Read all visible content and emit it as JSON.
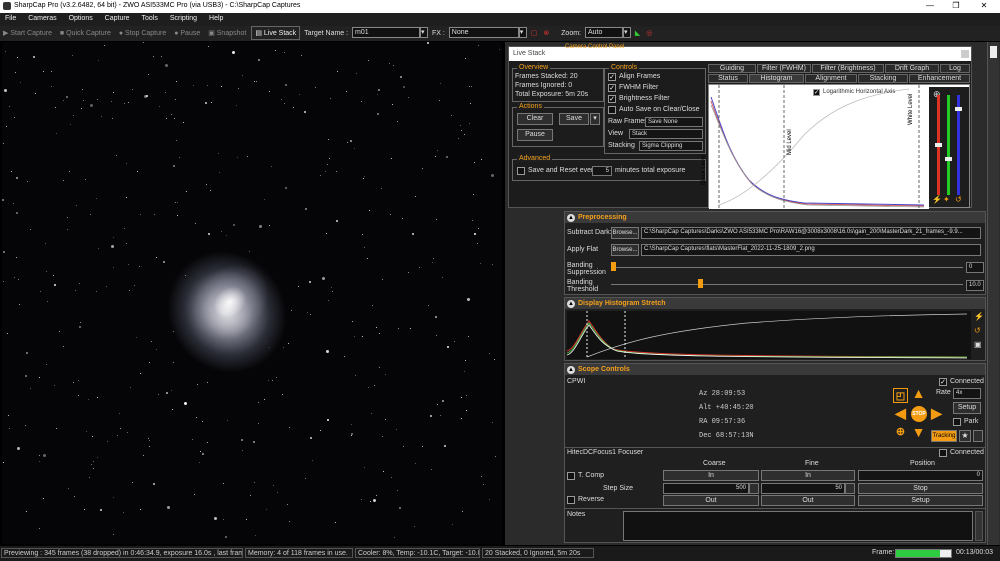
{
  "window": {
    "title": "SharpCap Pro (v3.2.6482, 64 bit) - ZWO ASI533MC Pro (via USB3) - C:\\SharpCap Captures",
    "minimize": "—",
    "maximize": "❐",
    "close": "✕"
  },
  "menu": [
    "File",
    "Cameras",
    "Options",
    "Capture",
    "Tools",
    "Scripting",
    "Help"
  ],
  "toolbar": {
    "start_capture": "Start Capture",
    "quick_capture": "Quick Capture",
    "stop_capture": "Stop Capture",
    "pause": "Pause",
    "snapshot": "Snapshot",
    "live_stack": "Live Stack",
    "target_label": "Target Name :",
    "target_value": "m01",
    "fx_label": "FX :",
    "fx_value": "None",
    "zoom_label": "Zoom:",
    "zoom_value": "Auto"
  },
  "live_stack": {
    "title": "Live Stack",
    "camera_panel_title": "Camera Control Panel",
    "overview": {
      "title": "Overview",
      "frames_stacked": "Frames Stacked: 20",
      "frames_ignored": "Frames Ignored: 0",
      "total_exposure": "Total Exposure: 5m 20s"
    },
    "actions": {
      "title": "Actions",
      "clear": "Clear",
      "save": "Save",
      "pause": "Pause"
    },
    "controls": {
      "title": "Controls",
      "align_frames": "Align Frames",
      "fwhm_filter": "FWHM Filter",
      "brightness_filter": "Brightness Filter",
      "auto_save": "Auto Save on Clear/Close",
      "raw_frames_label": "Raw Frames",
      "raw_frames_value": "Save None",
      "view_label": "View",
      "view_value": "Stack",
      "stacking_label": "Stacking",
      "stacking_value": "Sigma Clipping"
    },
    "advanced": {
      "title": "Advanced",
      "save_reset": "Save and Reset every",
      "minutes_value": "5",
      "minutes_label": "minutes total exposure"
    },
    "tabs_top": [
      "Guiding",
      "Filter (FWHM)",
      "Filter (Brightness)",
      "Drift Graph",
      "Log"
    ],
    "tabs_bottom": [
      "Status",
      "Histogram",
      "Alignment",
      "Stacking",
      "Enhancement"
    ],
    "histogram": {
      "log_axis": "Logarithmic Horizontal Axis",
      "black_level": "Black Level",
      "mid_level": "Mid Level",
      "white_level": "White Level"
    }
  },
  "preprocessing": {
    "title": "Preprocessing",
    "subtract_dark_label": "Subtract Dark:",
    "browse": "Browse...",
    "dark_path": "C:\\SharpCap Captures\\Darks\\ZWO ASI533MC Pro\\RAW16@3008x3008\\16.0s\\gain_200\\MasterDark_21_frames_-9.9...",
    "apply_flat_label": "Apply Flat",
    "flat_path": "C:\\SharpCap Captures\\flats\\MasterFlat_2022-11-25-1809_2.png",
    "banding_suppression": "Banding Suppression",
    "banding_suppression_value": "0",
    "banding_threshold": "Banding Threshold",
    "banding_threshold_value": "10.0"
  },
  "display_histogram": {
    "title": "Display Histogram Stretch"
  },
  "scope": {
    "title": "Scope Controls",
    "mount": "CPWI",
    "connected": "Connected",
    "az": "Az   28:09:53",
    "alt": "Alt  +40:45:20",
    "ra": "RA   09:57:36",
    "dec": "Dec  68:57:13N",
    "rate_label": "Rate",
    "rate_value": "4x",
    "setup": "Setup",
    "park": "Park",
    "tracking": "Tracking",
    "stop": "STOP"
  },
  "focuser": {
    "name": "HitecDCFocus1 Focuser",
    "connected": "Connected",
    "coarse": "Coarse",
    "fine": "Fine",
    "position": "Position",
    "t_comp": "T. Comp",
    "in": "In",
    "out": "Out",
    "position_value": "0",
    "step_size": "Step Size",
    "coarse_step": "500",
    "fine_step": "50",
    "stop": "Stop",
    "reverse": "Reverse",
    "setup": "Setup"
  },
  "notes": {
    "title": "Notes"
  },
  "status": {
    "preview": "Previewing : 345 frames (38 dropped) in 0:46:34.9, exposure 16.0s , last frame 16.5",
    "memory": "Memory: 4 of 118 frames in use.",
    "cooler": "Cooler: 8%, Temp: -10.1C, Target: -10.0C",
    "stacked": "20 Stacked, 0 Ignored, 5m 20s",
    "frame_label": "Frame:",
    "frame_progress": 0.8,
    "frame_time": "00:13/00:03"
  }
}
